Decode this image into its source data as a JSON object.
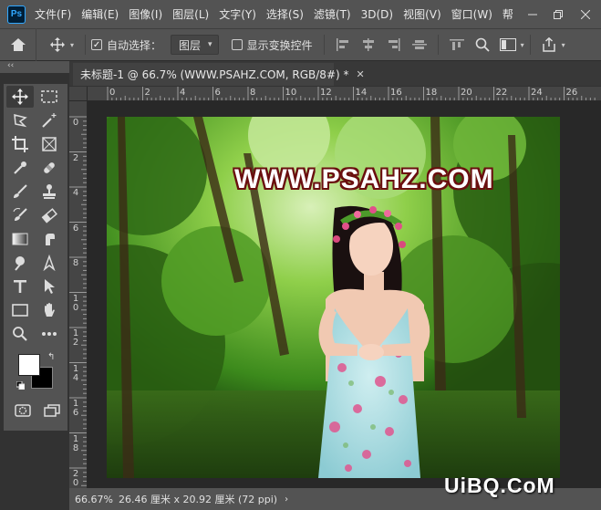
{
  "menubar": {
    "logo": "Ps",
    "items": [
      "文件(F)",
      "编辑(E)",
      "图像(I)",
      "图层(L)",
      "文字(Y)",
      "选择(S)",
      "滤镜(T)",
      "3D(D)",
      "视图(V)",
      "窗口(W)",
      "帮"
    ],
    "window_controls": [
      "minimize-icon",
      "restore-icon",
      "close-icon"
    ]
  },
  "optionsbar": {
    "auto_select_label": "自动选择：",
    "auto_select_checked": true,
    "auto_select_target": "图层",
    "show_transform_label": "显示变换控件",
    "show_transform_checked": false
  },
  "toolbar": {
    "collapse_glyph": "‹‹",
    "tools": [
      "move-tool-icon",
      "marquee-tool-icon",
      "lasso-tool-icon",
      "magic-wand-icon",
      "crop-tool-icon",
      "frame-tool-icon",
      "eyedropper-icon",
      "healing-brush-icon",
      "brush-tool-icon",
      "clone-stamp-icon",
      "history-brush-icon",
      "eraser-icon",
      "gradient-tool-icon",
      "smudge-tool-icon",
      "dodge-tool-icon",
      "pen-tool-icon",
      "type-tool-icon",
      "path-selection-icon",
      "rectangle-tool-icon",
      "hand-tool-icon",
      "zoom-tool-icon",
      "more-tools-icon",
      "quick-mask-icon",
      "screen-mode-icon"
    ],
    "foreground_color": "#ffffff",
    "background_color": "#000000"
  },
  "document": {
    "tab_title": "未标题-1 @ 66.7% (WWW.PSAHZ.COM, RGB/8#) *",
    "ruler_h": [
      "0",
      "2",
      "4",
      "6",
      "8",
      "10",
      "12",
      "14",
      "16",
      "18",
      "20",
      "22",
      "24",
      "26"
    ],
    "ruler_v": [
      "0",
      "2",
      "4",
      "6",
      "8",
      "1\n0",
      "1\n2",
      "1\n4",
      "1\n6",
      "1\n8",
      "2\n0"
    ],
    "watermark_text": "WWW.PSAHZ.COM"
  },
  "statusbar": {
    "zoom": "66.67%",
    "doc_size": "26.46 厘米 x 20.92 厘米 (72 ppi)",
    "arrow": "›"
  },
  "site_logo": "UiBQ.CoM",
  "colors": {
    "accent": "#31a8ff",
    "panel": "#535353",
    "canvas_bg": "#282828"
  }
}
